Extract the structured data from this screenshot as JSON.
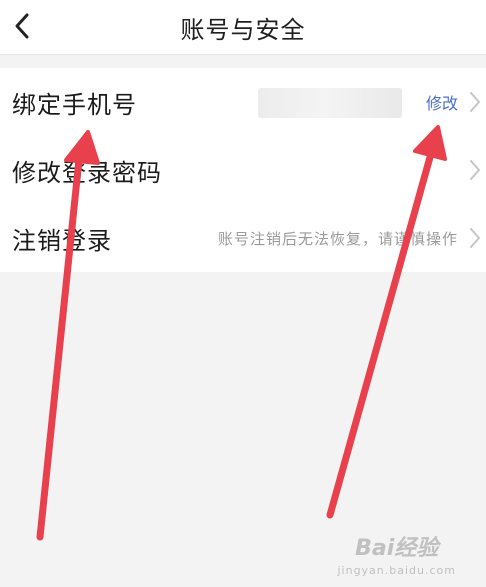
{
  "header": {
    "title": "账号与安全"
  },
  "rows": [
    {
      "label": "绑定手机号",
      "action": "修改"
    },
    {
      "label": "修改登录密码"
    },
    {
      "label": "注销登录",
      "hint": "账号注销后无法恢复，请谨慎操作"
    }
  ],
  "watermark": {
    "logo": "Bai经验",
    "sub": "jingyan.baidu.com"
  },
  "colors": {
    "link": "#4a6fd0",
    "annotation_arrow": "#e8414d"
  },
  "icons": {
    "back": "chevron-left-icon",
    "row_arrow": "chevron-right-icon"
  }
}
